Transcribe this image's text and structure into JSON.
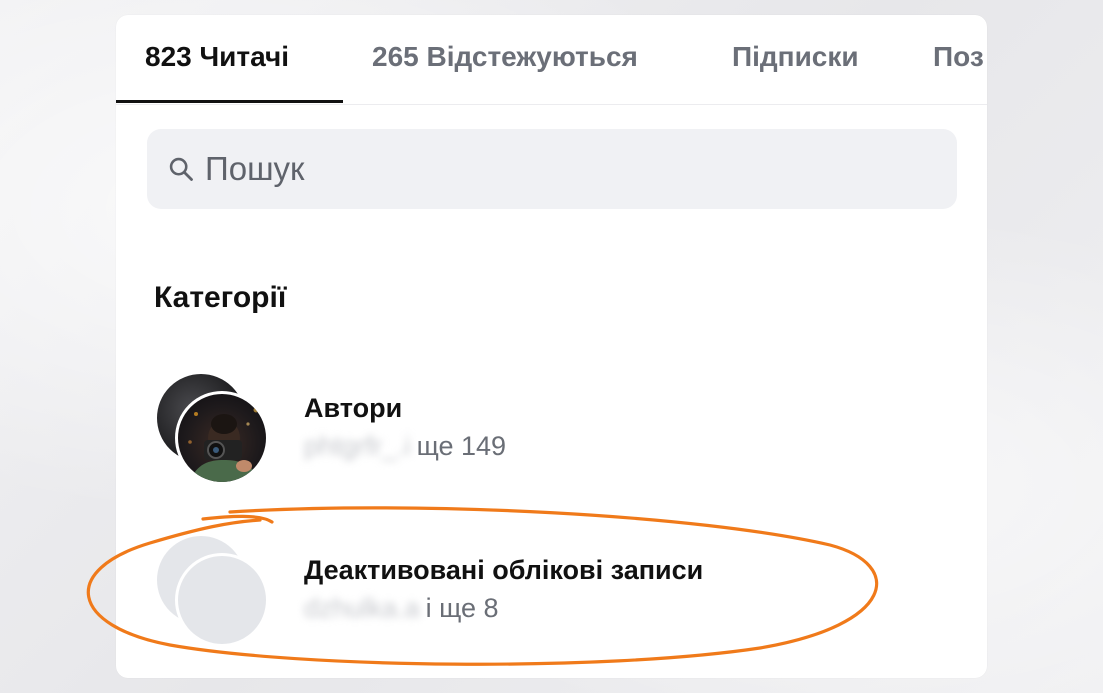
{
  "tabs": [
    {
      "label": "823 Читачі",
      "active": true
    },
    {
      "label": "265 Відстежуються",
      "active": false
    },
    {
      "label": "Підписки",
      "active": false
    },
    {
      "label": "Поз",
      "active": false
    }
  ],
  "search": {
    "placeholder": "Пошук",
    "icon": "search-icon"
  },
  "categories": {
    "title": "Категорії",
    "items": [
      {
        "title": "Автори",
        "blurred_name": "phtgrfr_.i",
        "suffix": "ще 149"
      },
      {
        "title": "Деактивовані облікові записи",
        "blurred_name": "dzhulka.a",
        "suffix": "і ще 8"
      }
    ]
  },
  "colors": {
    "annotation": "#f07a1a",
    "active_tab": "#111111",
    "inactive_tab": "#6b6f78"
  }
}
